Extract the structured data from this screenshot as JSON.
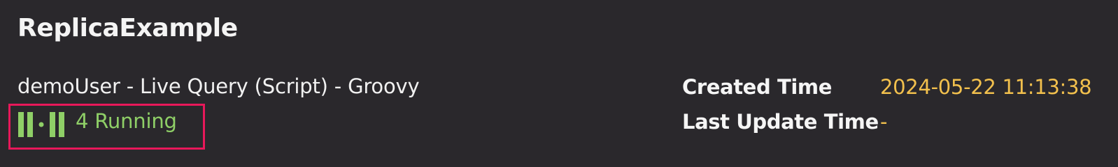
{
  "header": {
    "title": "ReplicaExample",
    "subtitle": "demoUser - Live Query (Script) - Groovy"
  },
  "status": {
    "text": "4 Running",
    "icon": "running-bars-icon",
    "color": "#8fcf67",
    "highlight_color": "#e8185a"
  },
  "meta": {
    "created_label": "Created Time",
    "created_value": "2024-05-22 11:13:38",
    "updated_label": "Last Update Time",
    "updated_value": "-",
    "value_color": "#f2c04d"
  }
}
